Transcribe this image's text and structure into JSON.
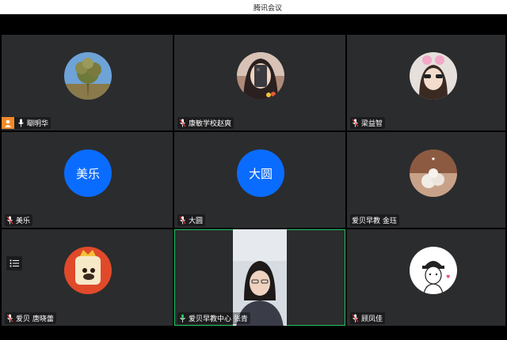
{
  "window": {
    "title": "腾讯会议"
  },
  "participants": [
    {
      "name": "瞓明华",
      "avatar": "photo",
      "mic": "muted",
      "host": true
    },
    {
      "name": "康敏学校赵爽",
      "avatar": "photo",
      "mic": "muted"
    },
    {
      "name": "梁益智",
      "avatar": "photo",
      "mic": "muted"
    },
    {
      "name": "美乐",
      "avatar": "text",
      "avatar_text": "美乐",
      "mic": "muted"
    },
    {
      "name": "大圆",
      "avatar": "text",
      "avatar_text": "大圆",
      "mic": "muted"
    },
    {
      "name": "爱贝早教 金珏",
      "avatar": "photo",
      "mic": "none"
    },
    {
      "name": "爱贝 唐晓蕾",
      "avatar": "photo",
      "mic": "muted"
    },
    {
      "name": "爱贝早教中心 张青",
      "avatar": "video",
      "mic": "active",
      "speaking": true
    },
    {
      "name": "顾凤佳",
      "avatar": "photo",
      "mic": "muted"
    }
  ],
  "icons": {
    "mic_muted": "mic-muted-icon",
    "mic_active": "mic-active-icon",
    "host": "host-person-icon",
    "menu": "list-menu-icon"
  },
  "colors": {
    "tile_bg": "#2b2c2e",
    "avatar_blue": "#0a6cff",
    "speaking_border": "#21c55d",
    "host_orange": "#f18a2a"
  }
}
